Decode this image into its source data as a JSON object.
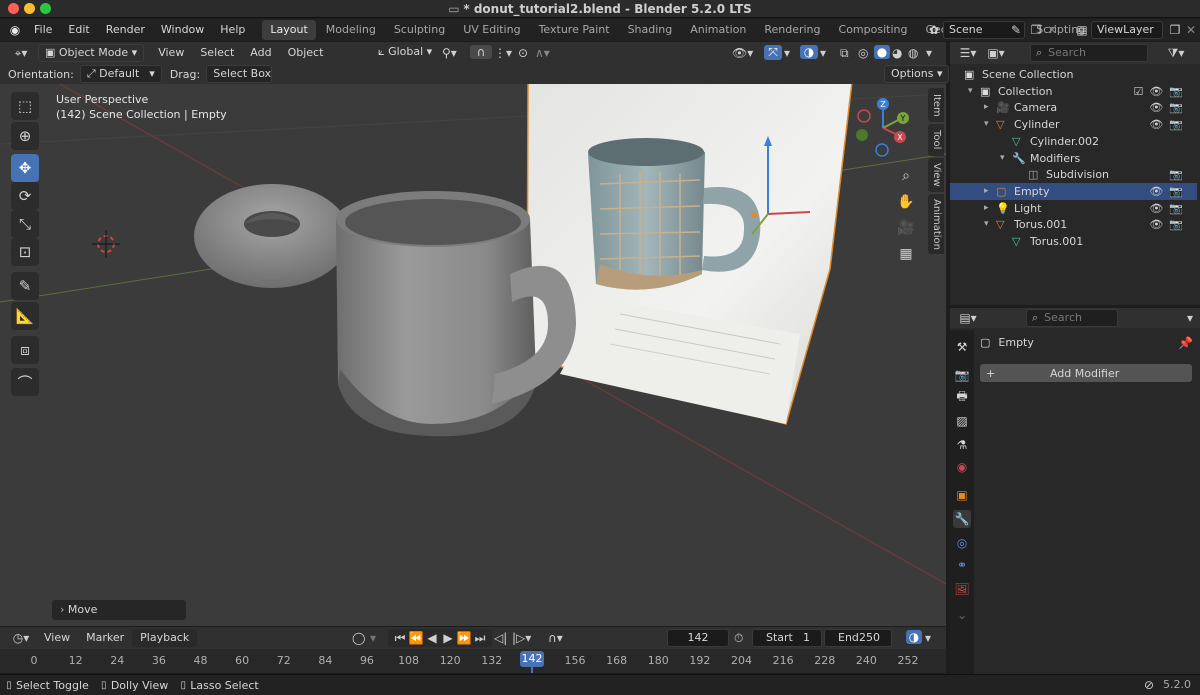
{
  "window": {
    "title": "* donut_tutorial2.blend - Blender 5.2.0 LTS"
  },
  "menu": [
    "File",
    "Edit",
    "Render",
    "Window",
    "Help"
  ],
  "workspaces": [
    "Layout",
    "Modeling",
    "Sculpting",
    "UV Editing",
    "Texture Paint",
    "Shading",
    "Animation",
    "Rendering",
    "Compositing",
    "Geometry Nodes",
    "Scripting"
  ],
  "active_workspace": "Layout",
  "scene": {
    "name": "Scene",
    "view_layer": "ViewLayer"
  },
  "viewport": {
    "mode": "Object Mode",
    "menus": [
      "View",
      "Select",
      "Add",
      "Object"
    ],
    "transform_orientation": "Global",
    "orientation_label": "Orientation:",
    "orientation_value": "Default",
    "drag_label": "Drag:",
    "drag_value": "Select Box",
    "options_label": "Options",
    "info_line1": "User Perspective",
    "info_line2": "(142) Scene Collection | Empty",
    "side_tabs": [
      "Item",
      "Tool",
      "View",
      "Animation"
    ],
    "last_op": "Move",
    "gizmo": {
      "x": "X",
      "y": "Y",
      "z": "Z"
    }
  },
  "timeline": {
    "menus": [
      "View",
      "Marker",
      "Playback"
    ],
    "current_frame": "142",
    "start_label": "Start",
    "start": "1",
    "end_label": "End",
    "end": "250",
    "ticks": [
      "0",
      "12",
      "24",
      "36",
      "48",
      "60",
      "72",
      "84",
      "96",
      "108",
      "120",
      "132",
      "142",
      "156",
      "168",
      "180",
      "192",
      "204",
      "216",
      "228",
      "240",
      "252"
    ]
  },
  "status": {
    "items": [
      "Select Toggle",
      "Dolly View",
      "Lasso Select"
    ],
    "version": "5.2.0"
  },
  "outliner": {
    "search_placeholder": "Search",
    "rows": [
      {
        "label": "Scene Collection",
        "indent": 0
      },
      {
        "label": "Collection",
        "indent": 1
      },
      {
        "label": "Camera",
        "indent": 2
      },
      {
        "label": "Cylinder",
        "indent": 2
      },
      {
        "label": "Cylinder.002",
        "indent": 3
      },
      {
        "label": "Modifiers",
        "indent": 3
      },
      {
        "label": "Subdivision",
        "indent": 4
      },
      {
        "label": "Empty",
        "indent": 2
      },
      {
        "label": "Light",
        "indent": 2
      },
      {
        "label": "Torus.001",
        "indent": 2
      },
      {
        "label": "Torus.001",
        "indent": 3
      }
    ]
  },
  "properties": {
    "search_placeholder": "Search",
    "object_name": "Empty",
    "add_modifier": "Add Modifier"
  },
  "colors": {
    "accent": "#4772b3",
    "selection": "#334d80",
    "x_axis": "#c9484f",
    "y_axis": "#7ba43a",
    "z_axis": "#3c7fd9"
  }
}
